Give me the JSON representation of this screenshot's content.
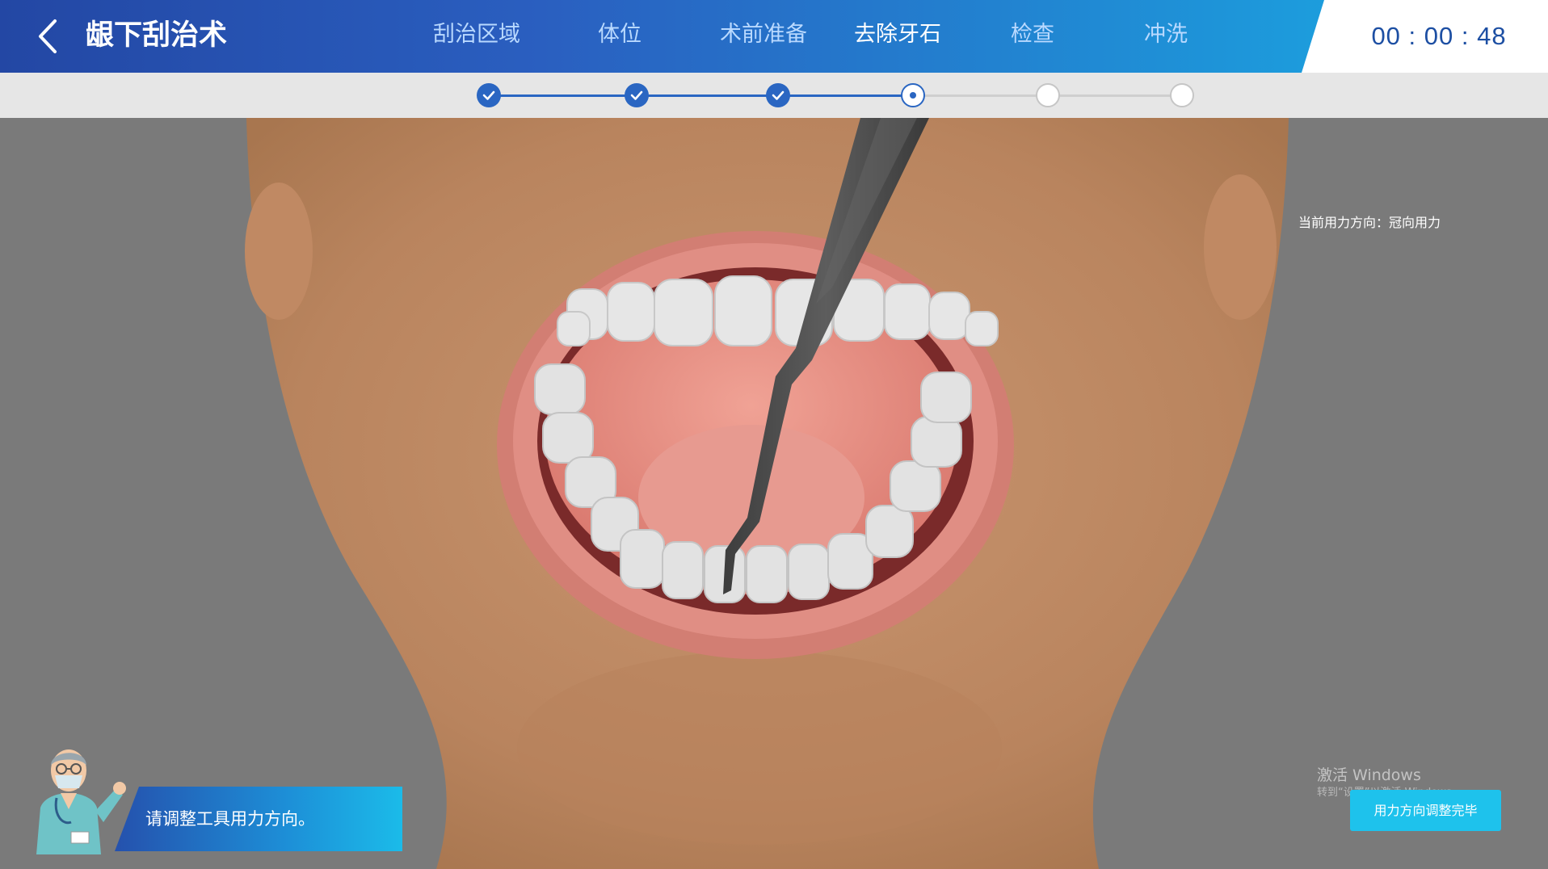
{
  "header": {
    "title": "龈下刮治术",
    "nav": [
      {
        "label": "刮治区域",
        "state": "done"
      },
      {
        "label": "体位",
        "state": "done"
      },
      {
        "label": "术前准备",
        "state": "done"
      },
      {
        "label": "去除牙石",
        "state": "active"
      },
      {
        "label": "检查",
        "state": "todo"
      },
      {
        "label": "冲洗",
        "state": "todo"
      }
    ],
    "timer": "00 : 00 : 48"
  },
  "scene": {
    "status_text": "当前用力方向：冠向用力"
  },
  "instruction": {
    "text": "请调整工具用力方向。"
  },
  "actions": {
    "confirm_label": "用力方向调整完毕"
  },
  "watermark": {
    "line1": "激活 Windows",
    "line2": "转到“设置”以激活 Windows。"
  },
  "colors": {
    "header_start": "#2347a4",
    "header_end": "#19b0e6",
    "accent": "#2a66c2",
    "button": "#1ec2ec",
    "background": "#7a7a7a"
  }
}
